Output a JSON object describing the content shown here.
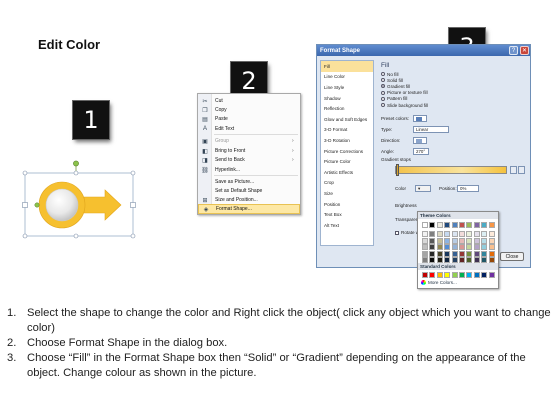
{
  "page": {
    "title": "Edit Color"
  },
  "badges": [
    "1",
    "2",
    "3"
  ],
  "context_menu": {
    "items": [
      {
        "icon": "scissors-icon",
        "glyph": "✂",
        "label": "Cut",
        "arrow": "",
        "disabled": false,
        "highlight": false
      },
      {
        "icon": "copy-icon",
        "glyph": "❐",
        "label": "Copy",
        "arrow": "",
        "disabled": false,
        "highlight": false
      },
      {
        "icon": "paste-icon",
        "glyph": "▤",
        "label": "Paste",
        "arrow": "",
        "disabled": false,
        "highlight": false
      },
      {
        "icon": "edit-text-icon",
        "glyph": "A",
        "label": "Edit Text",
        "arrow": "",
        "disabled": false,
        "highlight": false
      },
      {
        "icon": "group-icon",
        "glyph": "▣",
        "label": "Group",
        "arrow": "›",
        "disabled": true,
        "highlight": false
      },
      {
        "icon": "bring-to-front-icon",
        "glyph": "◧",
        "label": "Bring to Front",
        "arrow": "›",
        "disabled": false,
        "highlight": false
      },
      {
        "icon": "send-to-back-icon",
        "glyph": "◨",
        "label": "Send to Back",
        "arrow": "›",
        "disabled": false,
        "highlight": false
      },
      {
        "icon": "hyperlink-icon",
        "glyph": "⛓",
        "label": "Hyperlink...",
        "arrow": "",
        "disabled": false,
        "highlight": false
      },
      {
        "icon": "",
        "glyph": "",
        "label": "Save as Picture...",
        "arrow": "",
        "disabled": false,
        "highlight": false
      },
      {
        "icon": "",
        "glyph": "",
        "label": "Set as Default Shape",
        "arrow": "",
        "disabled": false,
        "highlight": false
      },
      {
        "icon": "size-position-icon",
        "glyph": "⊞",
        "label": "Size and Position...",
        "arrow": "",
        "disabled": false,
        "highlight": false
      },
      {
        "icon": "format-shape-icon",
        "glyph": "◈",
        "label": "Format Shape...",
        "arrow": "",
        "disabled": false,
        "highlight": true
      }
    ]
  },
  "dialog": {
    "title": "Format Shape",
    "help": "?",
    "close_glyph": "✕",
    "nav": [
      "Fill",
      "Line Color",
      "Line Style",
      "Shadow",
      "Reflection",
      "Glow and Soft Edges",
      "3-D Format",
      "3-D Rotation",
      "Picture Corrections",
      "Picture Color",
      "Artistic Effects",
      "Crop",
      "Size",
      "Position",
      "Text Box",
      "Alt Text"
    ],
    "active_nav": 0,
    "section_title": "Fill",
    "fill_options": [
      "No fill",
      "Solid fill",
      "Gradient fill",
      "Picture or texture fill",
      "Pattern fill",
      "Slide background fill"
    ],
    "selected_fill": 2,
    "preset_label": "Preset colors:",
    "type_label": "Type:",
    "type_value": "Linear",
    "direction_label": "Direction:",
    "angle_label": "Angle:",
    "angle_value": "270°",
    "stops_label": "Gradient stops",
    "color_label": "Color",
    "position_label": "Position:",
    "position_value": "0%",
    "brightness_label": "Brightness",
    "transparency_label": "Transparency",
    "rotate_label": "Rotate w",
    "close_button": "Close"
  },
  "palette": {
    "theme_title": "Theme Colors",
    "standard_title": "Standard Colors",
    "more_colors": "More Colors...",
    "theme_top": [
      "#ffffff",
      "#000000",
      "#eeece1",
      "#1f497d",
      "#4f81bd",
      "#c0504d",
      "#9bbb59",
      "#8064a2",
      "#4bacc6",
      "#f79646"
    ],
    "theme_shades": [
      [
        "#f2f2f2",
        "#7f7f7f",
        "#ddd9c3",
        "#c6d9f0",
        "#dbe5f1",
        "#f2dcdb",
        "#ebf1dd",
        "#e5e0ec",
        "#dbeef3",
        "#fdeada"
      ],
      [
        "#d8d8d8",
        "#595959",
        "#c4bd97",
        "#8db3e2",
        "#b8cce4",
        "#e5b9b7",
        "#d7e3bc",
        "#ccc1d9",
        "#b7dde8",
        "#fbd5b5"
      ],
      [
        "#bfbfbf",
        "#3f3f3f",
        "#938953",
        "#548dd4",
        "#95b3d7",
        "#d99694",
        "#c3d69b",
        "#b2a2c7",
        "#92cddc",
        "#fac08f"
      ],
      [
        "#a5a5a5",
        "#262626",
        "#494429",
        "#17365d",
        "#366092",
        "#953734",
        "#76923c",
        "#5f497a",
        "#31859b",
        "#e36c09"
      ],
      [
        "#7f7f7f",
        "#0c0c0c",
        "#1d1b10",
        "#0f243e",
        "#244061",
        "#632423",
        "#4f6128",
        "#3f3151",
        "#205867",
        "#974806"
      ]
    ],
    "standard": [
      "#c00000",
      "#ff0000",
      "#ffc000",
      "#ffff00",
      "#92d050",
      "#00b050",
      "#00b0f0",
      "#0070c0",
      "#002060",
      "#7030a0"
    ]
  },
  "instructions": [
    {
      "num": "1.",
      "text": "Select the shape to change the color and Right click the object( click any object which you want to change color)"
    },
    {
      "num": "2.",
      "text": "Choose Format Shape in the dialog box."
    },
    {
      "num": "3.",
      "text": "Choose “Fill” in the Format Shape box then “Solid” or “Gradient” depending on the appearance of the object. Change colour as shown in the picture."
    }
  ],
  "colors": {
    "accent_yellow": "#f6c02f",
    "highlight": "#fde8a5",
    "dialog_bg": "#dfe7f2"
  }
}
